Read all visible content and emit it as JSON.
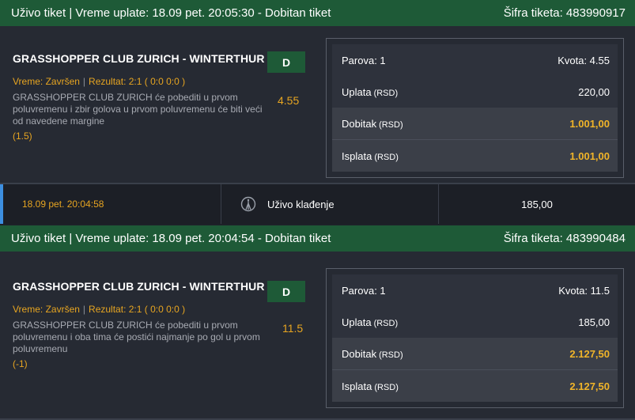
{
  "tickets": [
    {
      "header_left": "Uživo tiket | Vreme uplate: 18.09 pet. 20:05:30 - Dobitan tiket",
      "header_right": "Šifra tiketa: 483990917",
      "match": "GRASSHOPPER CLUB ZURICH - WINTERTHUR",
      "status": "Vreme: Završen",
      "result": "Rezultat: 2:1 ( 0:0 0:0 )",
      "description": "GRASSHOPPER CLUB ZURICH će pobediti u prvom poluvremenu i zbir golova u prvom poluvremenu će biti veći od navedene margine",
      "margin": "(1.5)",
      "odds": "4.55",
      "pick": "D",
      "summary": {
        "pairs_label": "Parova: 1",
        "odds_label": "Kvota: 4.55",
        "stake_label": "Uplata",
        "stake_currency": "(RSD)",
        "stake_value": "220,00",
        "win_label": "Dobitak",
        "win_currency": "(RSD)",
        "win_value": "1.001,00",
        "payout_label": "Isplata",
        "payout_currency": "(RSD)",
        "payout_value": "1.001,00"
      }
    },
    {
      "header_left": "Uživo tiket | Vreme uplate: 18.09 pet. 20:04:54 - Dobitan tiket",
      "header_right": "Šifra tiketa: 483990484",
      "match": "GRASSHOPPER CLUB ZURICH - WINTERTHUR",
      "status": "Vreme: Završen",
      "result": "Rezultat: 2:1 ( 0:0 0:0 )",
      "description": "GRASSHOPPER CLUB ZURICH će pobediti u prvom poluvremenu i oba tima će postići najmanje po gol u prvom poluvremenu",
      "margin": "(-1)",
      "odds": "11.5",
      "pick": "D",
      "summary": {
        "pairs_label": "Parova: 1",
        "odds_label": "Kvota: 11.5",
        "stake_label": "Uplata",
        "stake_currency": "(RSD)",
        "stake_value": "185,00",
        "win_label": "Dobitak",
        "win_currency": "(RSD)",
        "win_value": "2.127,50",
        "payout_label": "Isplata",
        "payout_currency": "(RSD)",
        "payout_value": "2.127,50"
      }
    }
  ],
  "live_bar": {
    "time": "18.09 pet. 20:04:58",
    "type": "Uživo klađenje",
    "amount": "185,00"
  },
  "icons": {
    "live": "live-betting-icon"
  },
  "colors": {
    "header_green": "#1e5a37",
    "accent_gold": "#e7a521",
    "accent_blue": "#3d8fe0"
  }
}
